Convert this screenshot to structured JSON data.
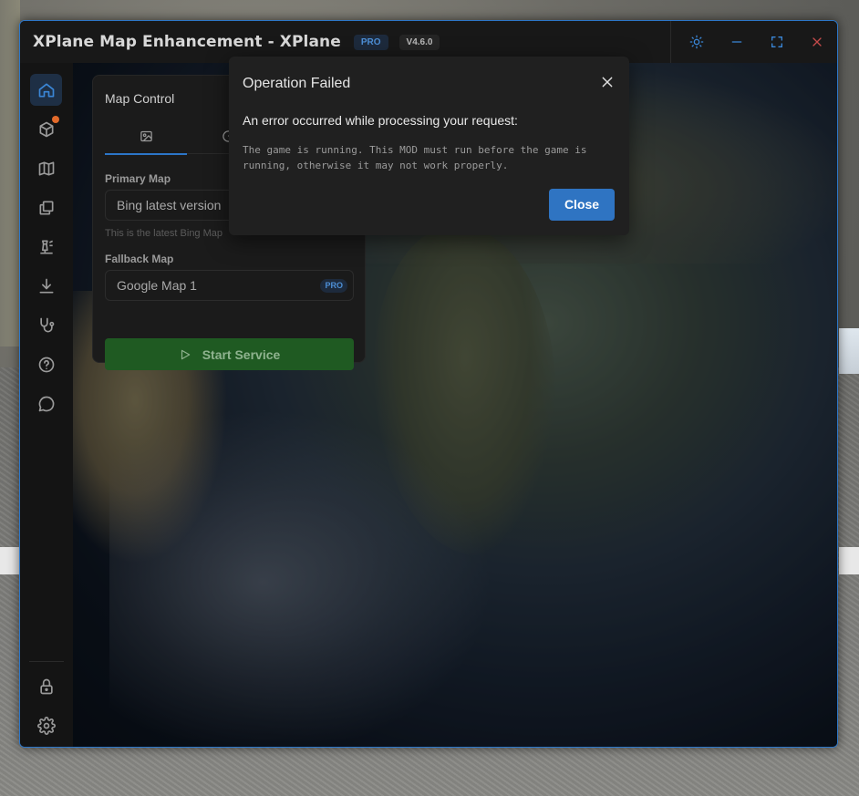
{
  "window": {
    "title": "XPlane Map Enhancement - XPlane",
    "edition_badge": "PRO",
    "version_badge": "V4.6.0"
  },
  "titlebar_actions": [
    {
      "name": "theme-toggle",
      "icon": "sun-icon"
    },
    {
      "name": "minimize",
      "icon": "minimize-icon"
    },
    {
      "name": "maximize",
      "icon": "maximize-icon"
    },
    {
      "name": "close",
      "icon": "close-icon"
    }
  ],
  "sidebar": {
    "items": [
      {
        "icon": "home-icon",
        "active": true
      },
      {
        "icon": "package-icon",
        "notification": true
      },
      {
        "icon": "map-icon"
      },
      {
        "icon": "layers-icon"
      },
      {
        "icon": "airport-tower-icon"
      },
      {
        "icon": "download-icon"
      },
      {
        "icon": "stethoscope-icon"
      },
      {
        "icon": "help-icon"
      },
      {
        "icon": "chat-icon"
      }
    ],
    "bottom_items": [
      {
        "icon": "lock-icon"
      },
      {
        "icon": "settings-icon"
      }
    ]
  },
  "map_control": {
    "title": "Map Control",
    "tabs": [
      {
        "icon": "image-icon",
        "active": true
      },
      {
        "icon": "gauge-icon"
      }
    ],
    "primary_map_label": "Primary Map",
    "primary_map_value": "Bing latest version",
    "primary_map_hint": "This is the latest Bing Map",
    "fallback_map_label": "Fallback Map",
    "fallback_map_value": "Google Map 1",
    "fallback_badge": "PRO",
    "start_button": "Start Service"
  },
  "dialog": {
    "title": "Operation Failed",
    "message": "An error occurred while processing your request:",
    "detail": "The game is running. This MOD must run before the game is running, otherwise it may not work properly.",
    "close_button": "Close"
  },
  "colors": {
    "accent": "#2c76c8",
    "success": "#1f5a22",
    "notification": "#e36a2a"
  }
}
